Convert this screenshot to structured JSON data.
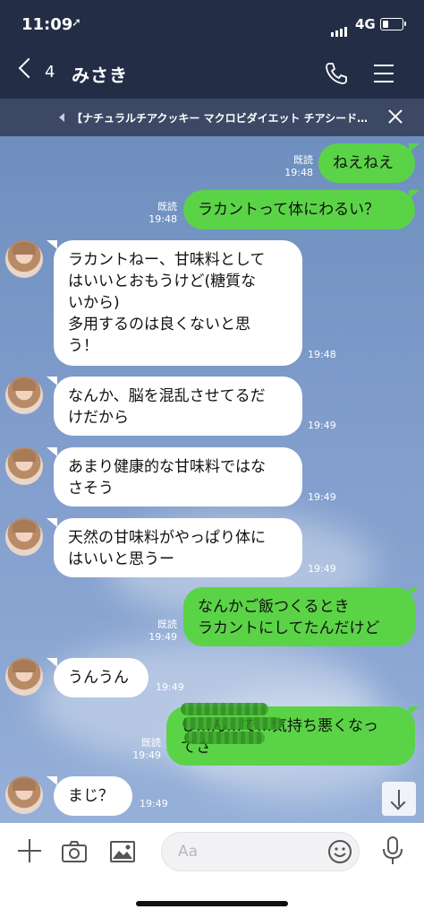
{
  "status": {
    "time": "11:09",
    "network": "4G",
    "battery_level": 0.3
  },
  "header": {
    "back_count": "4",
    "title": "みさき"
  },
  "banner": {
    "text": "【ナチュラルチアクッキー マクロビダイエット チアシード…"
  },
  "messages": [
    {
      "side": "out",
      "text": "ねえねえ",
      "read": "既読",
      "time": "19:48"
    },
    {
      "side": "out",
      "text": "ラカントって体にわるい？",
      "read": "既読",
      "time": "19:48"
    },
    {
      "side": "in",
      "lines": [
        "ラカントねー、甘味料として",
        "はいいとおもうけど(糖質な",
        "いから)",
        "多用するのは良くないと思",
        "う！"
      ],
      "time": "19:48"
    },
    {
      "side": "in",
      "lines": [
        "なんか、脳を混乱させてるだ",
        "けだから"
      ],
      "time": "19:49"
    },
    {
      "side": "in",
      "lines": [
        "あまり健康的な甘味料ではな",
        "さそう"
      ],
      "time": "19:49"
    },
    {
      "side": "in",
      "lines": [
        "天然の甘味料がやっぱり体に",
        "はいいと思うー"
      ],
      "time": "19:49"
    },
    {
      "side": "out",
      "lines": [
        "なんかご飯つくるとき",
        "ラカントにしてたんだけど"
      ],
      "read": "既読",
      "time": "19:49"
    },
    {
      "side": "in",
      "text": "うんうん",
      "time": "19:49"
    },
    {
      "side": "out",
      "lines": [
        "し…ん…で…気持ち悪くなっ",
        "てさ"
      ],
      "read": "既読",
      "time": "19:49"
    },
    {
      "side": "in",
      "text": "まじ？",
      "time": "19:49"
    }
  ],
  "input": {
    "placeholder": "Aa"
  },
  "colors": {
    "header": "#232e46",
    "banner": "#3d4864",
    "outgoing": "#5bd347",
    "incoming": "#ffffff"
  },
  "icons": [
    "back-chevron-icon",
    "phone-icon",
    "menu-icon",
    "banner-arrow-icon",
    "close-icon",
    "scroll-down-icon",
    "plus-icon",
    "camera-icon",
    "image-icon",
    "emoji-icon",
    "mic-icon"
  ]
}
